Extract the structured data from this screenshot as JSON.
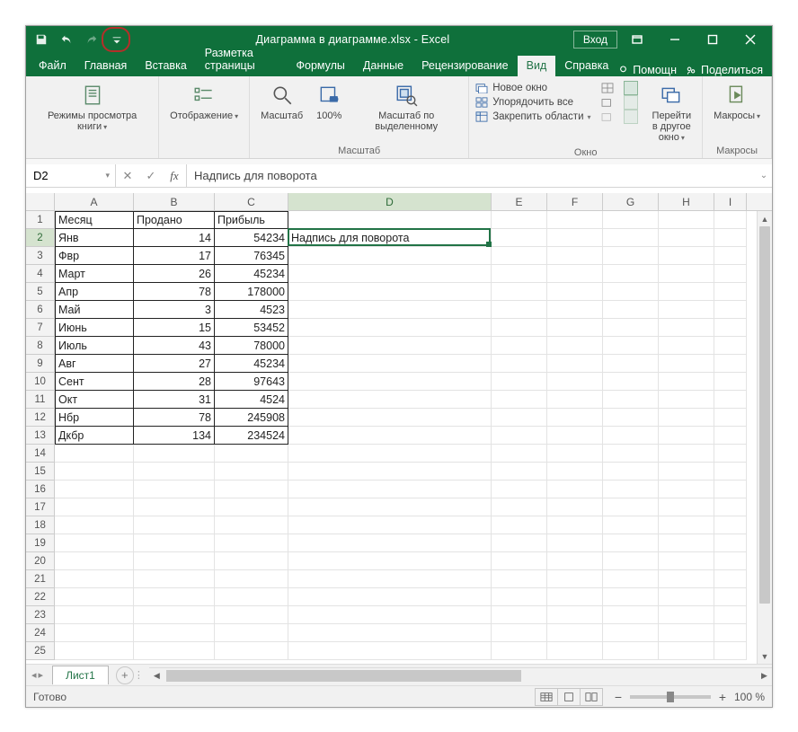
{
  "title": "Диаграмма в диаграмме.xlsx - Excel",
  "signin": "Вход",
  "tabs": {
    "file": "Файл",
    "home": "Главная",
    "insert": "Вставка",
    "pagelayout": "Разметка страницы",
    "formulas": "Формулы",
    "data": "Данные",
    "review": "Рецензирование",
    "view": "Вид",
    "help": "Справка"
  },
  "tell_me": "Помощн",
  "share": "Поделиться",
  "ribbon": {
    "group_views": "",
    "btn_views": "Режимы просмотра книги",
    "btn_show": "Отображение",
    "group_zoom": "Масштаб",
    "btn_zoom": "Масштаб",
    "btn_100": "100%",
    "btn_zoom_sel": "Масштаб по выделенному",
    "group_window": "Окно",
    "mi_new": "Новое окно",
    "mi_arrange": "Упорядочить все",
    "mi_freeze": "Закрепить области",
    "btn_switch": "Перейти в другое окно",
    "group_macros": "Макросы",
    "btn_macros": "Макросы"
  },
  "namebox": "D2",
  "formula": "Надпись для поворота",
  "columns": [
    "A",
    "B",
    "C",
    "D",
    "E",
    "F",
    "G",
    "H",
    "I"
  ],
  "headers": {
    "A": "Месяц",
    "B": "Продано",
    "C": "Прибыль"
  },
  "selected_cell_text": "Надпись для поворота",
  "data_rows": [
    {
      "m": "Янв",
      "s": "14",
      "p": "54234"
    },
    {
      "m": "Фвр",
      "s": "17",
      "p": "76345"
    },
    {
      "m": "Март",
      "s": "26",
      "p": "45234"
    },
    {
      "m": "Апр",
      "s": "78",
      "p": "178000"
    },
    {
      "m": "Май",
      "s": "3",
      "p": "4523"
    },
    {
      "m": "Июнь",
      "s": "15",
      "p": "53452"
    },
    {
      "m": "Июль",
      "s": "43",
      "p": "78000"
    },
    {
      "m": "Авг",
      "s": "27",
      "p": "45234"
    },
    {
      "m": "Сент",
      "s": "28",
      "p": "97643"
    },
    {
      "m": "Окт",
      "s": "31",
      "p": "4524"
    },
    {
      "m": "Нбр",
      "s": "78",
      "p": "245908"
    },
    {
      "m": "Дкбр",
      "s": "134",
      "p": "234524"
    }
  ],
  "sheet": "Лист1",
  "status": "Готово",
  "zoom": "100 %"
}
